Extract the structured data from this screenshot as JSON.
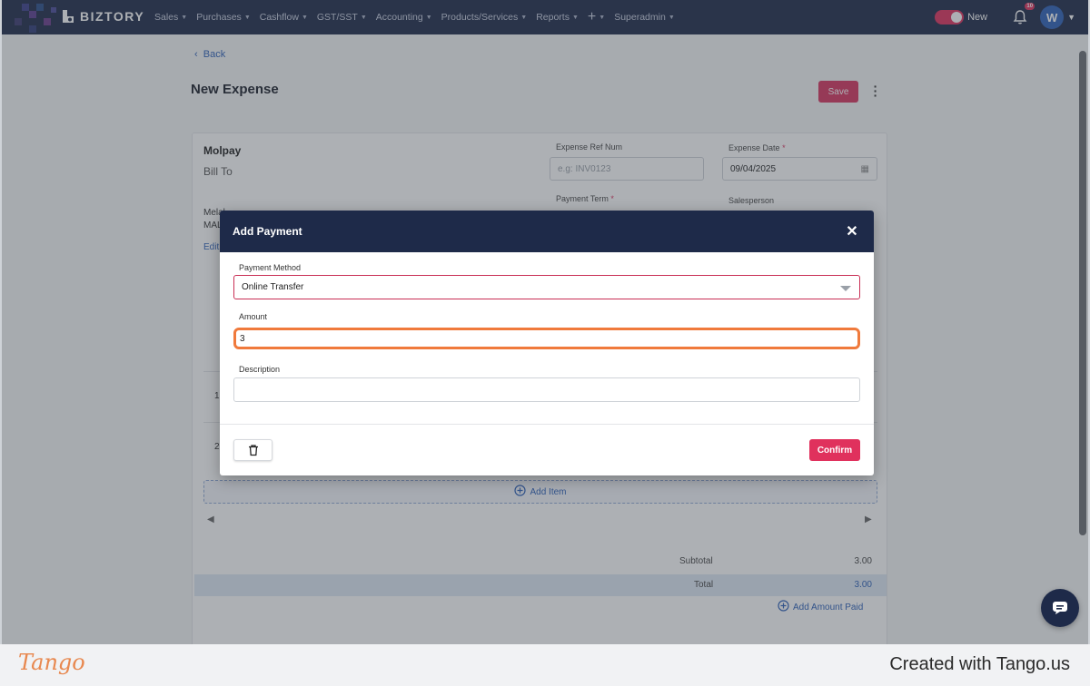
{
  "app": {
    "brand": "BIZTORY",
    "menu": [
      {
        "label": "Sales"
      },
      {
        "label": "Purchases"
      },
      {
        "label": "Cashflow"
      },
      {
        "label": "GST/SST"
      },
      {
        "label": "Accounting"
      },
      {
        "label": "Products/Services"
      },
      {
        "label": "Reports"
      }
    ],
    "menu_plus": "+",
    "menu_admin": "Superadmin",
    "toggle_label": "New",
    "notif_count": "10",
    "avatar_initial": "W"
  },
  "page": {
    "back_label": "Back",
    "title": "New Expense",
    "save_label": "Save",
    "vendor_name": "Molpay",
    "bill_to_label": "Bill To",
    "address_line1": "Melal",
    "address_line2": "MAL",
    "edit_label": "Edit",
    "fields": {
      "ref_label": "Expense Ref Num",
      "ref_placeholder": "e.g: INV0123",
      "date_label": "Expense Date",
      "date_value": "09/04/2025",
      "term_label": "Payment Term",
      "salesperson_label": "Salesperson"
    },
    "row_numbers": [
      "1",
      "2"
    ],
    "add_item_label": "Add Item",
    "subtotal_label": "Subtotal",
    "subtotal_value": "3.00",
    "total_label": "Total",
    "total_value": "3.00",
    "add_amount_paid_label": "Add Amount Paid"
  },
  "modal": {
    "title": "Add Payment",
    "payment_method_label": "Payment Method",
    "payment_method_value": "Online Transfer",
    "amount_label": "Amount",
    "amount_value": "3",
    "description_label": "Description",
    "description_value": "",
    "confirm_label": "Confirm"
  },
  "footer": {
    "logo_text": "Tango",
    "credit": "Created with Tango.us"
  },
  "colors": {
    "nav_bg": "#1e2a49",
    "accent": "#e0315d",
    "link": "#2e61b8",
    "focus_ring": "#f07a3c"
  }
}
